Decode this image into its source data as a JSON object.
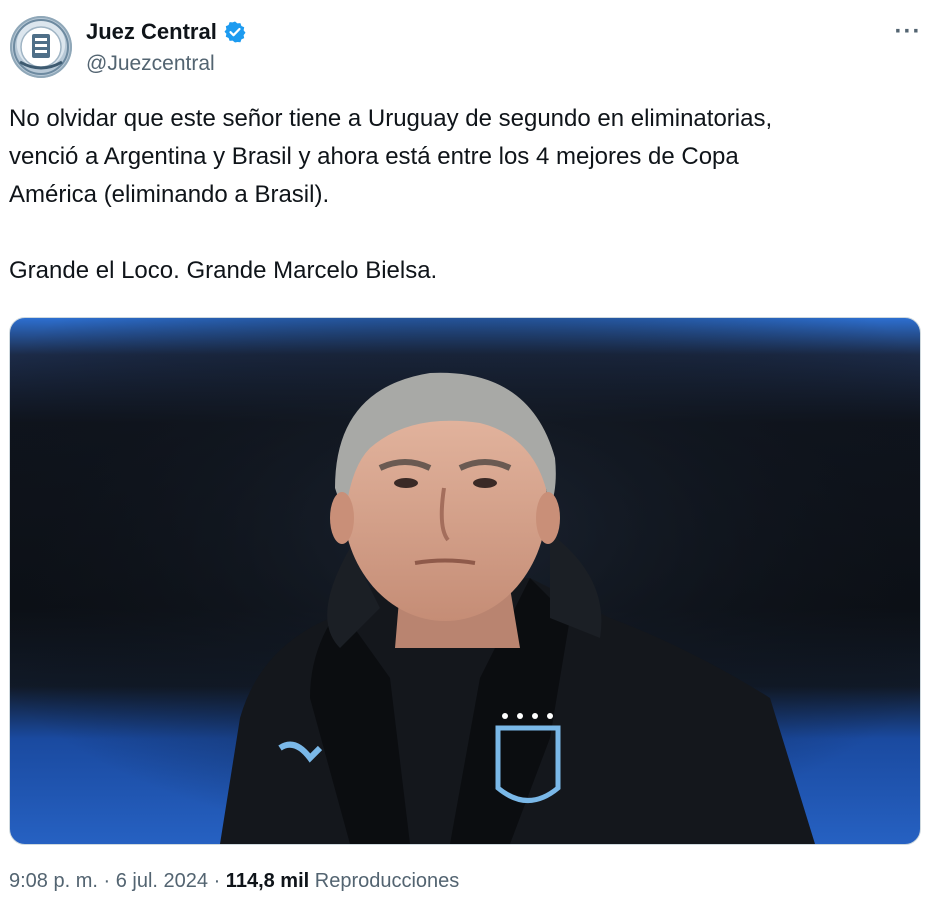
{
  "author": {
    "name": "Juez Central",
    "handle": "@Juezcentral",
    "verified": true,
    "avatar_icon": "referee-logo-icon"
  },
  "more_icon": "more-horizontal-icon",
  "more_label": "···",
  "tweet": {
    "paragraph1_line1": "No olvidar que este señor tiene a Uruguay de segundo en eliminatorias,",
    "paragraph1_line2": "venció a Argentina y Brasil y ahora está entre los 4 mejores de Copa",
    "paragraph1_line3": "América (eliminando a Brasil).",
    "paragraph2": "Grande el Loco. Grande Marcelo Bielsa."
  },
  "media": {
    "type": "photo",
    "subject": "man-in-black-jacket-icon"
  },
  "meta": {
    "time": "9:08 p. m.",
    "separator1": " · ",
    "date": "6 jul. 2024",
    "separator2": " · ",
    "views_count": "114,8 mil",
    "views_label": " Reproducciones"
  },
  "colors": {
    "text": "#0f1419",
    "secondary": "#536471",
    "verified": "#1d9bf0"
  }
}
